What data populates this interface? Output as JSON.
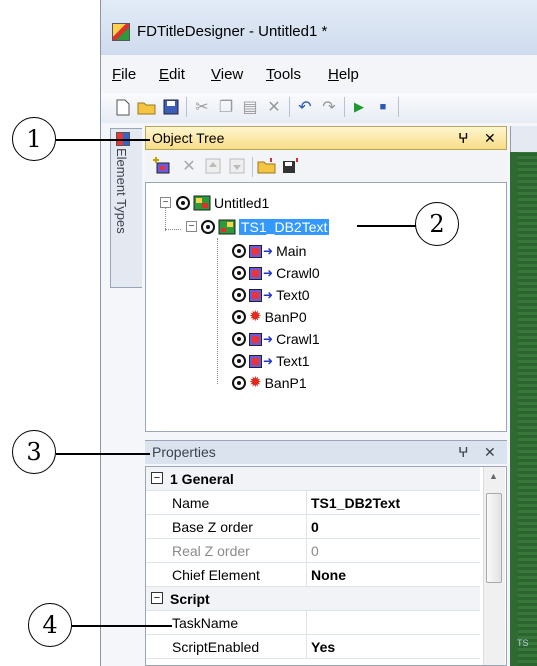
{
  "window": {
    "title": "FDTitleDesigner - Untitled1 *",
    "app_icon": "app-logo-icon"
  },
  "menu": {
    "items": [
      {
        "label": "File",
        "underline": "F",
        "rest": "ile"
      },
      {
        "label": "Edit",
        "underline": "E",
        "rest": "dit"
      },
      {
        "label": "View",
        "underline": "V",
        "rest": "iew"
      },
      {
        "label": "Tools",
        "underline": "T",
        "rest": "ools"
      },
      {
        "label": "Help",
        "underline": "H",
        "rest": "elp"
      }
    ]
  },
  "toolbar": {
    "buttons": [
      "new-icon",
      "open-icon",
      "save-icon",
      "cut-icon",
      "copy-icon",
      "paste-icon",
      "delete-icon",
      "undo-icon",
      "redo-icon",
      "play-icon",
      "stop-icon"
    ]
  },
  "side_tab": {
    "label": "Element Types"
  },
  "object_tree": {
    "title": "Object Tree",
    "pin_glyph": "p",
    "close_glyph": "✕",
    "tools": [
      "add-element-icon",
      "delete-icon",
      "move-up-icon",
      "move-down-icon",
      "import-icon",
      "export-icon"
    ],
    "root": "Untitled1",
    "selected": "TS1_DB2Text",
    "children": [
      {
        "label": "Main",
        "icon": "crawl-icon"
      },
      {
        "label": "Crawl0",
        "icon": "crawl-icon"
      },
      {
        "label": "Text0",
        "icon": "crawl-icon"
      },
      {
        "label": "BanP0",
        "icon": "banner-icon"
      },
      {
        "label": "Crawl1",
        "icon": "crawl-icon"
      },
      {
        "label": "Text1",
        "icon": "crawl-icon"
      },
      {
        "label": "BanP1",
        "icon": "banner-icon"
      }
    ]
  },
  "properties": {
    "title": "Properties",
    "categories": [
      {
        "name": "1 General",
        "rows": [
          {
            "key": "Name",
            "value": "TS1_DB2Text",
            "bold": true,
            "readonly": false
          },
          {
            "key": "Base Z order",
            "value": "0",
            "bold": true,
            "readonly": false
          },
          {
            "key": "Real Z order",
            "value": "0",
            "bold": false,
            "readonly": true
          },
          {
            "key": "Chief Element",
            "value": "None",
            "bold": true,
            "readonly": false
          }
        ]
      },
      {
        "name": "Script",
        "rows": [
          {
            "key": "TaskName",
            "value": "",
            "bold": false,
            "readonly": false
          },
          {
            "key": "ScriptEnabled",
            "value": "Yes",
            "bold": true,
            "readonly": false
          }
        ]
      }
    ]
  },
  "canvas": {
    "corner_text": "TS"
  },
  "callouts": [
    "1",
    "2",
    "3",
    "4"
  ],
  "colors": {
    "selection": "#3399ff",
    "header_active": "#f8dd86",
    "canvas": "#2e6a31"
  }
}
